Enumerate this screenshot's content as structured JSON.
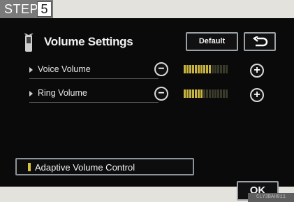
{
  "step": {
    "label": "STEP",
    "number": "5"
  },
  "header": {
    "title": "Volume Settings",
    "default_label": "Default",
    "back_icon": "return-arrow-icon"
  },
  "settings": [
    {
      "label": "Voice Volume",
      "level": 0.62,
      "segments": 16
    },
    {
      "label": "Ring Volume",
      "level": 0.43,
      "segments": 16
    }
  ],
  "adaptive": {
    "label": "Adaptive Volume Control",
    "state": "on",
    "indicator_color": "#d8c23a"
  },
  "ok_label": "OK",
  "image_code": "CLY3BAH011",
  "colors": {
    "screen_bg": "#0a0a0a",
    "level_on": "#c8b442",
    "button_border": "#9aa2a8"
  }
}
